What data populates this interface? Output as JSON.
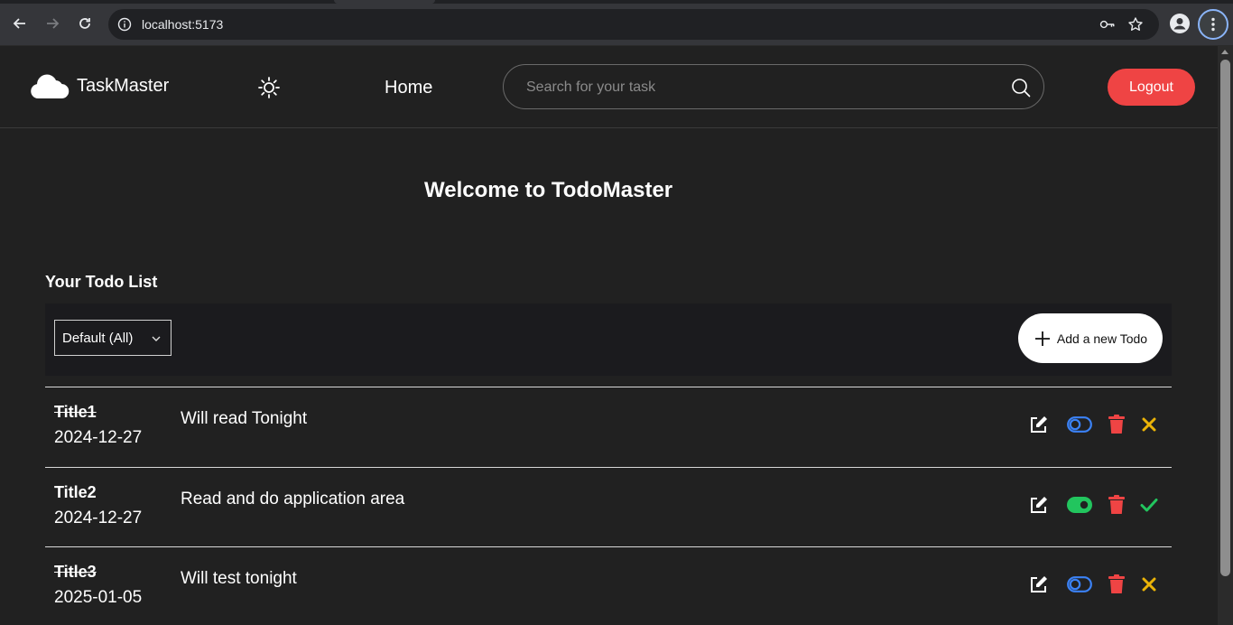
{
  "browser": {
    "url": "localhost:5173"
  },
  "navbar": {
    "brand": "TaskMaster",
    "home_label": "Home",
    "search_placeholder": "Search for your task",
    "logout_label": "Logout"
  },
  "main": {
    "welcome": "Welcome to TodoMaster",
    "list_heading": "Your Todo List",
    "filter_selected": "Default (All)",
    "add_label": "Add a new Todo"
  },
  "todos": [
    {
      "title": "Title1",
      "date": "2024-12-27",
      "description": "Will read Tonight",
      "completed": false
    },
    {
      "title": "Title2",
      "date": "2024-12-27",
      "description": "Read and do application area",
      "completed": true
    },
    {
      "title": "Title3",
      "date": "2025-01-05",
      "description": "Will test tonight",
      "completed": false
    }
  ],
  "colors": {
    "logout": "#ef4444",
    "toggle_off": "#3b82f6",
    "toggle_on": "#22c55e",
    "delete": "#ef4444",
    "incomplete_x": "#eab308",
    "complete_check": "#22c55e"
  }
}
